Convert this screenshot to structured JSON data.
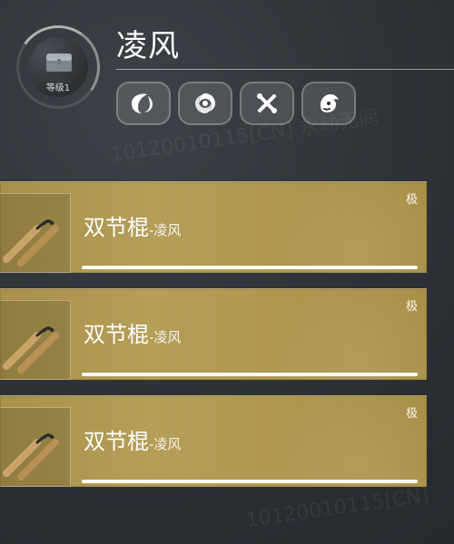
{
  "header": {
    "title": "凌风",
    "level_label": "等级1",
    "icons": [
      "crescent-claw-icon",
      "spiral-icon",
      "cross-icon",
      "beast-face-icon"
    ]
  },
  "watermark": {
    "lines": [
      "10120010115[CN]",
      "永劫无间"
    ]
  },
  "items": [
    {
      "name": "双节棍",
      "suffix": "-凌风",
      "rarity": "极",
      "progress": 1.0
    },
    {
      "name": "双节棍",
      "suffix": "-凌风",
      "rarity": "极",
      "progress": 1.0
    },
    {
      "name": "双节棍",
      "suffix": "-凌风",
      "rarity": "极",
      "progress": 1.0
    }
  ],
  "colors": {
    "card_gold": "#b59e57",
    "background": "#2f3439",
    "text": "#ffffff"
  }
}
